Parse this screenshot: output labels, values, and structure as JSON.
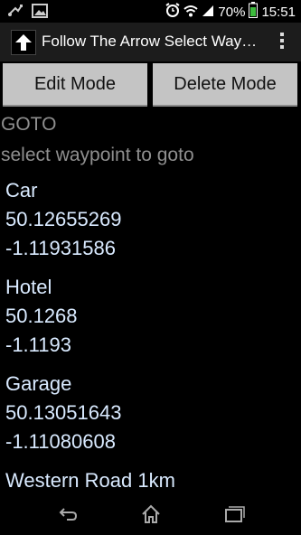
{
  "status_bar": {
    "battery_percent": "70%",
    "time": "15:51",
    "icons": [
      "usb-icon",
      "image-notification-icon",
      "alarm-icon",
      "wifi-icon",
      "signal-icon",
      "battery-icon"
    ]
  },
  "action_bar": {
    "title": "Follow The Arrow Select Waypoint",
    "app_icon": "up-arrow-icon",
    "overflow_icon": "overflow-menu-icon"
  },
  "buttons": {
    "edit_mode": "Edit Mode",
    "delete_mode": "Delete Mode"
  },
  "header": {
    "goto": "GOTO",
    "hint": "select waypoint to goto"
  },
  "waypoints": [
    {
      "name": "Car",
      "lat": "50.12655269",
      "lon": "-1.11931586"
    },
    {
      "name": "Hotel",
      "lat": "50.1268",
      "lon": "-1.1193"
    },
    {
      "name": "Garage",
      "lat": "50.13051643",
      "lon": "-1.11080608"
    },
    {
      "name": "Western Road 1km"
    }
  ],
  "nav_bar": {
    "icons": [
      "back-icon",
      "home-icon",
      "recent-apps-icon"
    ]
  }
}
